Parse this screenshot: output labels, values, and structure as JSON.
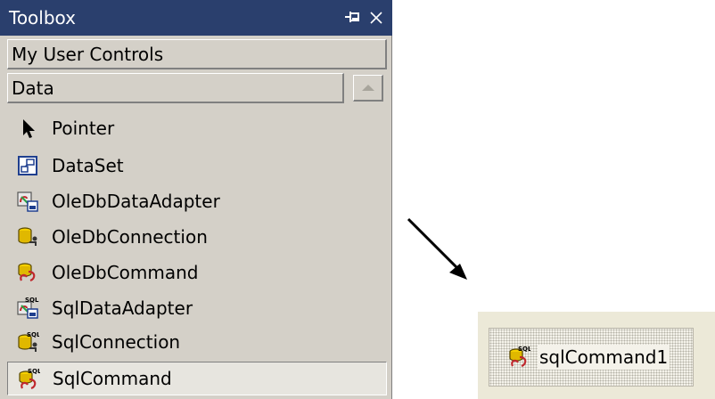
{
  "toolbox": {
    "title": "Toolbox",
    "pin_icon": "pin-icon",
    "close_icon": "close-icon",
    "tabs": [
      {
        "label": "My User Controls"
      },
      {
        "label": "Data"
      }
    ],
    "items": [
      {
        "label": "Pointer",
        "icon": "pointer-icon"
      },
      {
        "label": "DataSet",
        "icon": "dataset-icon"
      },
      {
        "label": "OleDbDataAdapter",
        "icon": "oledb-data-adapter-icon"
      },
      {
        "label": "OleDbConnection",
        "icon": "oledb-connection-icon"
      },
      {
        "label": "OleDbCommand",
        "icon": "oledb-command-icon"
      },
      {
        "label": "SqlDataAdapter",
        "icon": "sql-data-adapter-icon"
      },
      {
        "label": "SqlConnection",
        "icon": "sql-connection-icon"
      },
      {
        "label": "SqlCommand",
        "icon": "sql-command-icon"
      }
    ],
    "selected_item": "SqlCommand"
  },
  "component_tray": {
    "component_name": "sqlCommand1",
    "icon": "sql-command-icon"
  },
  "colors": {
    "titlebar": "#2a3f6d",
    "panel": "#d4d0c8",
    "tray": "#ece9d8"
  }
}
